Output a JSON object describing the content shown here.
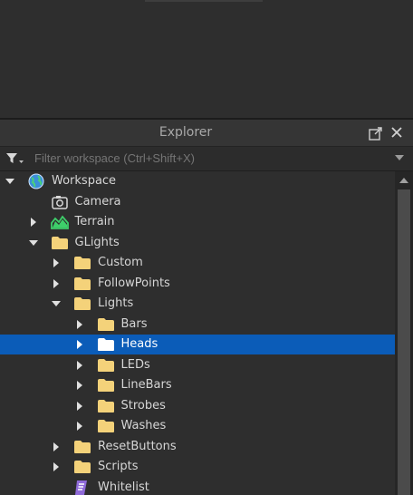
{
  "explorer": {
    "title": "Explorer",
    "filter_placeholder": "Filter workspace (Ctrl+Shift+X)"
  },
  "tree": [
    {
      "label": "Workspace",
      "icon": "workspace-icon",
      "expander": "expanded",
      "depth": 0
    },
    {
      "label": "Camera",
      "icon": "camera-icon",
      "expander": "none",
      "depth": 1
    },
    {
      "label": "Terrain",
      "icon": "terrain-icon",
      "expander": "collapsed",
      "depth": 1
    },
    {
      "label": "GLights",
      "icon": "folder-icon",
      "expander": "expanded",
      "depth": 1
    },
    {
      "label": "Custom",
      "icon": "folder-icon",
      "expander": "collapsed",
      "depth": 2
    },
    {
      "label": "FollowPoints",
      "icon": "folder-icon",
      "expander": "collapsed",
      "depth": 2
    },
    {
      "label": "Lights",
      "icon": "folder-icon",
      "expander": "expanded",
      "depth": 2
    },
    {
      "label": "Bars",
      "icon": "folder-icon",
      "expander": "collapsed",
      "depth": 3
    },
    {
      "label": "Heads",
      "icon": "folder-icon",
      "expander": "collapsed",
      "depth": 3,
      "selected": true
    },
    {
      "label": "LEDs",
      "icon": "folder-icon",
      "expander": "collapsed",
      "depth": 3
    },
    {
      "label": "LineBars",
      "icon": "folder-icon",
      "expander": "collapsed",
      "depth": 3
    },
    {
      "label": "Strobes",
      "icon": "folder-icon",
      "expander": "collapsed",
      "depth": 3
    },
    {
      "label": "Washes",
      "icon": "folder-icon",
      "expander": "collapsed",
      "depth": 3
    },
    {
      "label": "ResetButtons",
      "icon": "folder-icon",
      "expander": "collapsed",
      "depth": 2
    },
    {
      "label": "Scripts",
      "icon": "folder-icon",
      "expander": "collapsed",
      "depth": 2
    },
    {
      "label": "Whitelist",
      "icon": "script-icon",
      "expander": "none",
      "depth": 2
    }
  ],
  "colors": {
    "selection": "#0b5cb8",
    "folder": "#f4d27a",
    "terrain": "#3ecf6a"
  }
}
